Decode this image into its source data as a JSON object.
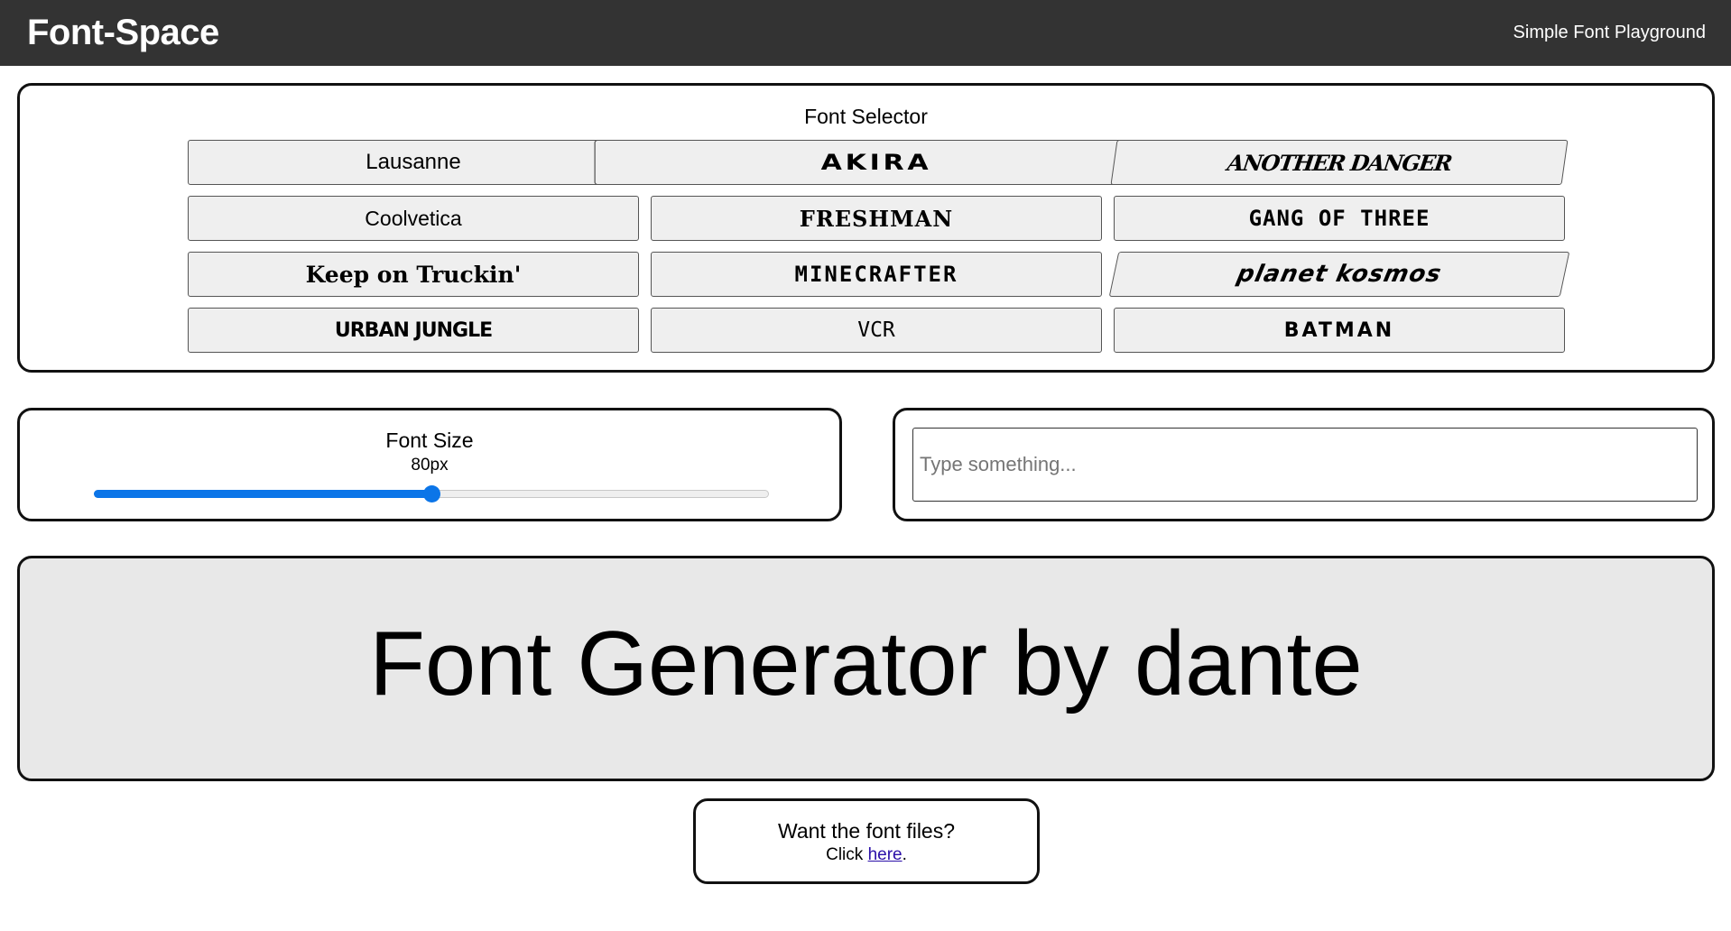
{
  "header": {
    "brand": "Font-Space",
    "tagline": "Simple Font Playground"
  },
  "font_selector": {
    "title": "Font Selector",
    "fonts": [
      "Lausanne",
      "AKIRA",
      "ANOTHER DANGER",
      "Coolvetica",
      "FRESHMAN",
      "GANG OF THREE",
      "Keep on Truckin'",
      "MINECRAFTER",
      "planet kosmos",
      "URBAN JUNGLE",
      "VCR",
      "BATMAN"
    ]
  },
  "font_size": {
    "title": "Font Size",
    "value_label": "80px",
    "fraction": 0.5
  },
  "text_input": {
    "placeholder": "Type something...",
    "value": ""
  },
  "preview": {
    "text": "Font Generator by dante"
  },
  "font_files": {
    "title": "Want the font files?",
    "prefix": "Click ",
    "link_text": "here",
    "suffix": "."
  },
  "colors": {
    "header_bg": "#333333",
    "accent": "#0b75e8",
    "preview_bg": "#e8e8e8",
    "link": "#2a0fa8"
  }
}
